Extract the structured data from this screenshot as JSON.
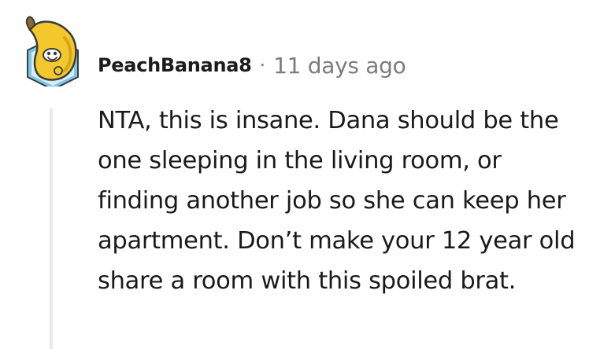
{
  "comment": {
    "author": "PeachBanana8",
    "separator": "·",
    "timestamp": "11 days ago",
    "body": "NTA, this is insane. Dana should be the one sleeping in the living room, or finding another job so she can keep her apartment. Don’t make your 12 year old share a room with this spoiled brat."
  },
  "avatar": {
    "icon": "banana-avatar-icon",
    "colors": {
      "banana": "#f2c82c",
      "banana_shadow": "#d9a518",
      "hex_frame": "#7ec6e6",
      "hex_inner": "#d6eef8"
    }
  },
  "colors": {
    "text": "#1a1a1b",
    "meta": "#7c7c7c",
    "thread_line": "#e8eaec"
  }
}
